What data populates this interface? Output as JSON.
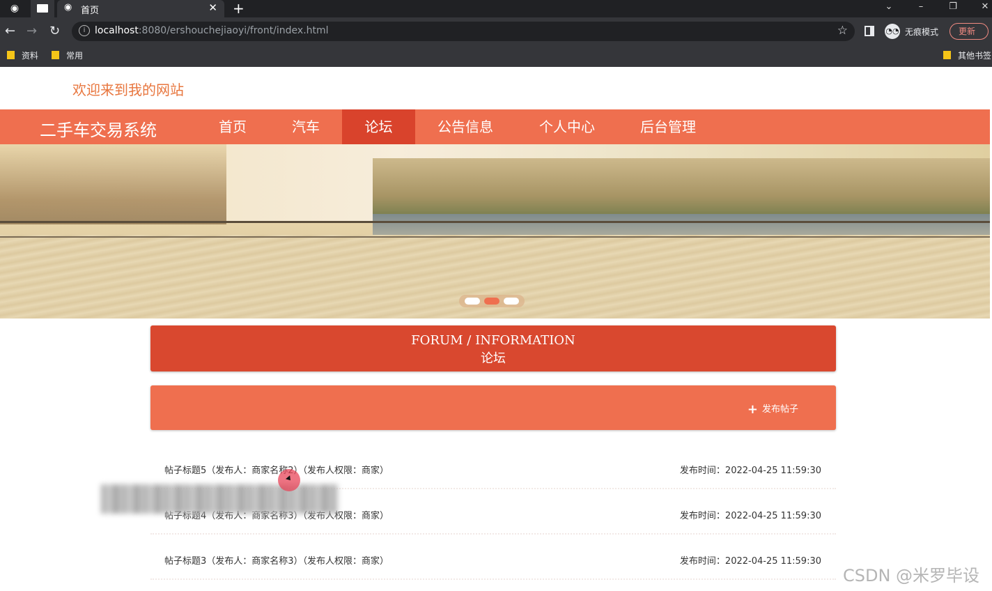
{
  "browser": {
    "tab_title": "首页",
    "url_host": "localhost",
    "url_rest": ":8080/ershouchejiaoyi/front/index.html",
    "incognito_label": "无痕模式",
    "update_label": "更新",
    "bookmarks": [
      "资料",
      "常用",
      "其他书签"
    ]
  },
  "header": {
    "welcome": "欢迎来到我的网站",
    "brand": "二手车交易系统"
  },
  "nav": {
    "items": [
      {
        "label": "首页",
        "active": false
      },
      {
        "label": "汽车",
        "active": false
      },
      {
        "label": "论坛",
        "active": true
      },
      {
        "label": "公告信息",
        "active": false
      },
      {
        "label": "个人中心",
        "active": false
      },
      {
        "label": "后台管理",
        "active": false
      }
    ]
  },
  "carousel": {
    "slide_count": 3,
    "active_index": 1
  },
  "section": {
    "title_en": "FORUM / INFORMATION",
    "title_cn": "论坛"
  },
  "toolbar": {
    "post_label": "发布帖子"
  },
  "posts": [
    {
      "title": "帖子标题5（发布人：商家名称2）（发布人权限：商家）",
      "time": "发布时间：2022-04-25 11:59:30"
    },
    {
      "title": "帖子标题4（发布人：商家名称3）（发布人权限：商家）",
      "time": "发布时间：2022-04-25 11:59:30"
    },
    {
      "title": "帖子标题3（发布人：商家名称3）（发布人权限：商家）",
      "time": "发布时间：2022-04-25 11:59:30"
    }
  ],
  "watermark": "CSDN @米罗毕设",
  "colors": {
    "accent": "#ef6f4f",
    "accent_dark": "#d9482f",
    "welcome_text": "#e8763e"
  }
}
